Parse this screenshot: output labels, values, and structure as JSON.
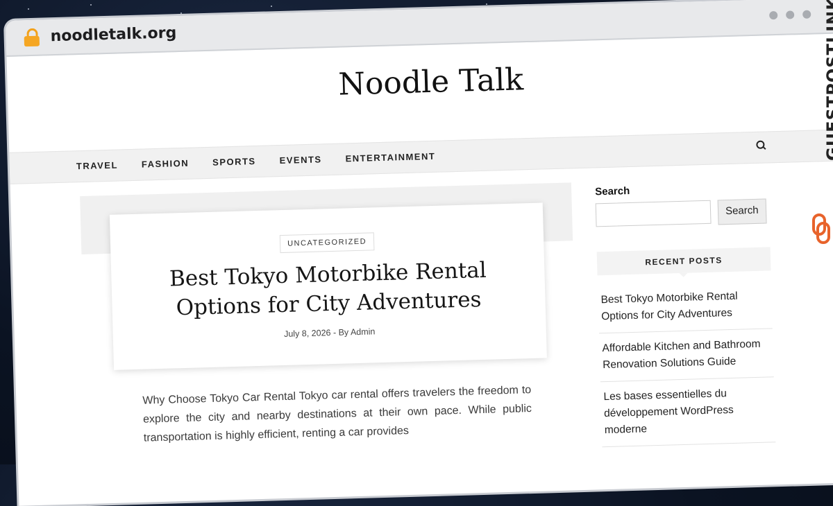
{
  "browser": {
    "url": "noodletalk.org"
  },
  "site": {
    "title": "Noodle Talk"
  },
  "nav": {
    "items": [
      "TRAVEL",
      "FASHION",
      "SPORTS",
      "EVENTS",
      "ENTERTAINMENT"
    ]
  },
  "post": {
    "category": "UNCATEGORIZED",
    "title": "Best Tokyo Motorbike Rental Options for City Adventures",
    "meta": "July 8, 2026 - By Admin",
    "excerpt": "Why Choose Tokyo Car Rental Tokyo car rental offers travelers the freedom to explore the city and nearby destinations at their own pace. While public transportation is highly efficient, renting a car provides"
  },
  "sidebar": {
    "search_label": "Search",
    "search_button": "Search",
    "recent_posts_title": "RECENT POSTS",
    "recent_posts": [
      "Best Tokyo Motorbike Rental Options for City Adventures",
      "Affordable Kitchen and Bathroom Renovation Solutions Guide",
      "Les bases essentielles du développement WordPress moderne"
    ]
  },
  "watermark": {
    "text": "GUESTPOSTLINKS",
    "accent": "#e8632b"
  }
}
